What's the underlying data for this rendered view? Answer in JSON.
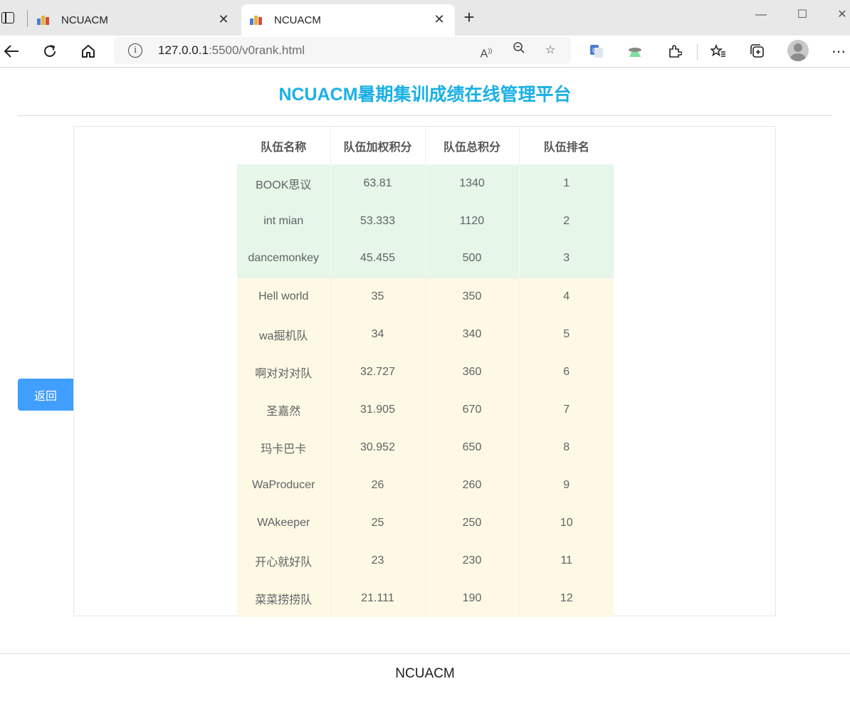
{
  "browser": {
    "tabs": [
      {
        "title": "NCUACM",
        "active": false
      },
      {
        "title": "NCUACM",
        "active": true
      }
    ],
    "url_host": "127.0.0.1",
    "url_path": ":5500/v0rank.html"
  },
  "page": {
    "title": "NCUACM暑期集训成绩在线管理平台",
    "back_label": "返回",
    "footer": "NCUACM"
  },
  "table": {
    "headers": [
      "队伍名称",
      "队伍加权积分",
      "队伍总积分",
      "队伍排名"
    ],
    "rows": [
      {
        "name": "BOOK思议",
        "weighted": "63.81",
        "total": "1340",
        "rank": "1",
        "tier": "green"
      },
      {
        "name": "int mian",
        "weighted": "53.333",
        "total": "1120",
        "rank": "2",
        "tier": "green"
      },
      {
        "name": "dancemonkey",
        "weighted": "45.455",
        "total": "500",
        "rank": "3",
        "tier": "green"
      },
      {
        "name": "Hell world",
        "weighted": "35",
        "total": "350",
        "rank": "4",
        "tier": "yellow"
      },
      {
        "name": "wa掘机队",
        "weighted": "34",
        "total": "340",
        "rank": "5",
        "tier": "yellow"
      },
      {
        "name": "啊对对对队",
        "weighted": "32.727",
        "total": "360",
        "rank": "6",
        "tier": "yellow"
      },
      {
        "name": "圣嘉然",
        "weighted": "31.905",
        "total": "670",
        "rank": "7",
        "tier": "yellow"
      },
      {
        "name": "玛卡巴卡",
        "weighted": "30.952",
        "total": "650",
        "rank": "8",
        "tier": "yellow"
      },
      {
        "name": "WaProducer",
        "weighted": "26",
        "total": "260",
        "rank": "9",
        "tier": "yellow"
      },
      {
        "name": "WAkeeper",
        "weighted": "25",
        "total": "250",
        "rank": "10",
        "tier": "yellow"
      },
      {
        "name": "开心就好队",
        "weighted": "23",
        "total": "230",
        "rank": "11",
        "tier": "yellow"
      },
      {
        "name": "菜菜捞捞队",
        "weighted": "21.111",
        "total": "190",
        "rank": "12",
        "tier": "yellow"
      }
    ]
  },
  "colors": {
    "title": "#1ab0e6",
    "back_button": "#409eff",
    "row_top3": "#e6f6e9",
    "row_other": "#fdf9e5"
  }
}
